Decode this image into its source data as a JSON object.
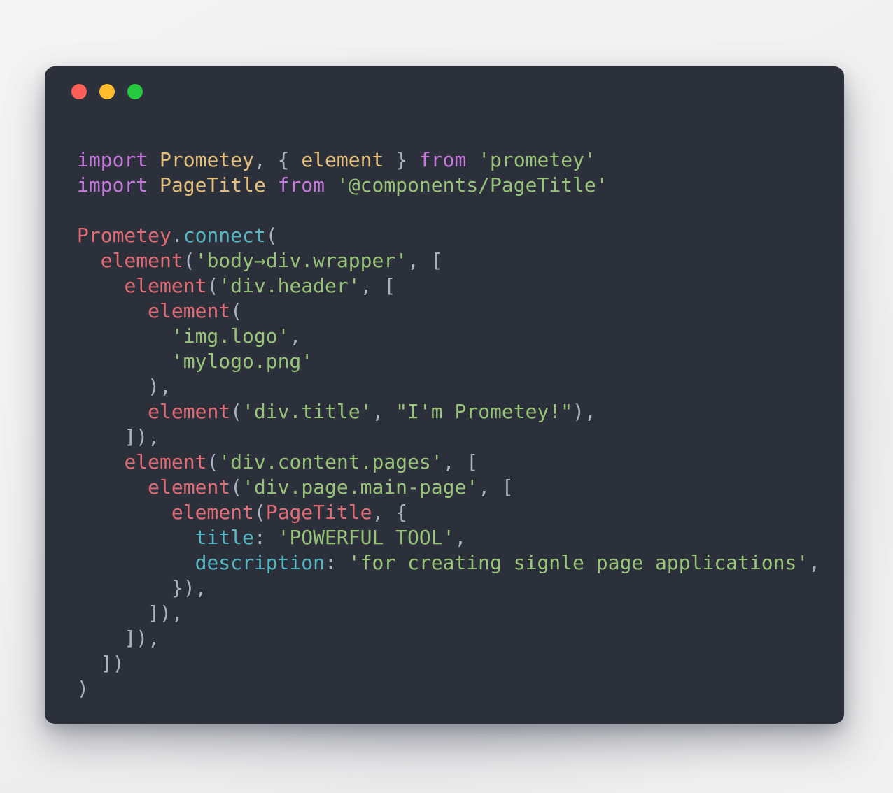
{
  "window": {
    "traffic_lights": [
      {
        "name": "close",
        "color": "#ff5f56"
      },
      {
        "name": "minimize",
        "color": "#ffbd2e"
      },
      {
        "name": "zoom",
        "color": "#27c93f"
      }
    ]
  },
  "theme": {
    "background": "#f1f1f1",
    "panel": "#2b303b",
    "keyword": "#c678dd",
    "string": "#98c379",
    "function": "#e06c75",
    "method": "#56b6c2",
    "identifier": "#e5c07b",
    "punctuation": "#abb2bf"
  },
  "code": {
    "language": "javascript",
    "lines": [
      {
        "n": 1,
        "tokens": [
          {
            "t": "import",
            "c": "kw"
          },
          {
            "t": " ",
            "c": "punc"
          },
          {
            "t": "Prometey",
            "c": "ident"
          },
          {
            "t": ", { ",
            "c": "punc"
          },
          {
            "t": "element",
            "c": "ident"
          },
          {
            "t": " } ",
            "c": "punc"
          },
          {
            "t": "from",
            "c": "kw"
          },
          {
            "t": " ",
            "c": "punc"
          },
          {
            "t": "'prometey'",
            "c": "str"
          }
        ]
      },
      {
        "n": 2,
        "tokens": [
          {
            "t": "import",
            "c": "kw"
          },
          {
            "t": " ",
            "c": "punc"
          },
          {
            "t": "PageTitle",
            "c": "ident"
          },
          {
            "t": " ",
            "c": "punc"
          },
          {
            "t": "from",
            "c": "kw"
          },
          {
            "t": " ",
            "c": "punc"
          },
          {
            "t": "'@components/PageTitle'",
            "c": "str"
          }
        ]
      },
      {
        "n": 3,
        "tokens": []
      },
      {
        "n": 4,
        "tokens": [
          {
            "t": "Prometey",
            "c": "fn"
          },
          {
            "t": ".",
            "c": "punc"
          },
          {
            "t": "connect",
            "c": "meth"
          },
          {
            "t": "(",
            "c": "punc"
          }
        ]
      },
      {
        "n": 5,
        "tokens": [
          {
            "t": "  ",
            "c": "punc"
          },
          {
            "t": "element",
            "c": "fn"
          },
          {
            "t": "(",
            "c": "punc"
          },
          {
            "t": "'body→div.wrapper'",
            "c": "str"
          },
          {
            "t": ", [",
            "c": "punc"
          }
        ]
      },
      {
        "n": 6,
        "tokens": [
          {
            "t": "    ",
            "c": "punc"
          },
          {
            "t": "element",
            "c": "fn"
          },
          {
            "t": "(",
            "c": "punc"
          },
          {
            "t": "'div.header'",
            "c": "str"
          },
          {
            "t": ", [",
            "c": "punc"
          }
        ]
      },
      {
        "n": 7,
        "tokens": [
          {
            "t": "      ",
            "c": "punc"
          },
          {
            "t": "element",
            "c": "fn"
          },
          {
            "t": "(",
            "c": "punc"
          }
        ]
      },
      {
        "n": 8,
        "tokens": [
          {
            "t": "        ",
            "c": "punc"
          },
          {
            "t": "'img.logo'",
            "c": "str"
          },
          {
            "t": ",",
            "c": "punc"
          }
        ]
      },
      {
        "n": 9,
        "tokens": [
          {
            "t": "        ",
            "c": "punc"
          },
          {
            "t": "'mylogo.png'",
            "c": "str"
          }
        ]
      },
      {
        "n": 10,
        "tokens": [
          {
            "t": "      ),",
            "c": "punc"
          }
        ]
      },
      {
        "n": 11,
        "tokens": [
          {
            "t": "      ",
            "c": "punc"
          },
          {
            "t": "element",
            "c": "fn"
          },
          {
            "t": "(",
            "c": "punc"
          },
          {
            "t": "'div.title'",
            "c": "str"
          },
          {
            "t": ", ",
            "c": "punc"
          },
          {
            "t": "\"I'm Prometey!\"",
            "c": "str"
          },
          {
            "t": "),",
            "c": "punc"
          }
        ]
      },
      {
        "n": 12,
        "tokens": [
          {
            "t": "    ]),",
            "c": "punc"
          }
        ]
      },
      {
        "n": 13,
        "tokens": [
          {
            "t": "    ",
            "c": "punc"
          },
          {
            "t": "element",
            "c": "fn"
          },
          {
            "t": "(",
            "c": "punc"
          },
          {
            "t": "'div.content.pages'",
            "c": "str"
          },
          {
            "t": ", [",
            "c": "punc"
          }
        ]
      },
      {
        "n": 14,
        "tokens": [
          {
            "t": "      ",
            "c": "punc"
          },
          {
            "t": "element",
            "c": "fn"
          },
          {
            "t": "(",
            "c": "punc"
          },
          {
            "t": "'div.page.main-page'",
            "c": "str"
          },
          {
            "t": ", [",
            "c": "punc"
          }
        ]
      },
      {
        "n": 15,
        "tokens": [
          {
            "t": "        ",
            "c": "punc"
          },
          {
            "t": "element",
            "c": "fn"
          },
          {
            "t": "(",
            "c": "punc"
          },
          {
            "t": "PageTitle",
            "c": "fn"
          },
          {
            "t": ", {",
            "c": "punc"
          }
        ]
      },
      {
        "n": 16,
        "tokens": [
          {
            "t": "          ",
            "c": "punc"
          },
          {
            "t": "title",
            "c": "meth"
          },
          {
            "t": ": ",
            "c": "punc"
          },
          {
            "t": "'POWERFUL TOOL'",
            "c": "str"
          },
          {
            "t": ",",
            "c": "punc"
          }
        ]
      },
      {
        "n": 17,
        "tokens": [
          {
            "t": "          ",
            "c": "punc"
          },
          {
            "t": "description",
            "c": "meth"
          },
          {
            "t": ": ",
            "c": "punc"
          },
          {
            "t": "'for creating signle page applications'",
            "c": "str"
          },
          {
            "t": ",",
            "c": "punc"
          }
        ]
      },
      {
        "n": 18,
        "tokens": [
          {
            "t": "        }),",
            "c": "punc"
          }
        ]
      },
      {
        "n": 19,
        "tokens": [
          {
            "t": "      ]),",
            "c": "punc"
          }
        ]
      },
      {
        "n": 20,
        "tokens": [
          {
            "t": "    ]),",
            "c": "punc"
          }
        ]
      },
      {
        "n": 21,
        "tokens": [
          {
            "t": "  ])",
            "c": "punc"
          }
        ]
      },
      {
        "n": 22,
        "tokens": [
          {
            "t": ")",
            "c": "punc"
          }
        ]
      }
    ]
  }
}
